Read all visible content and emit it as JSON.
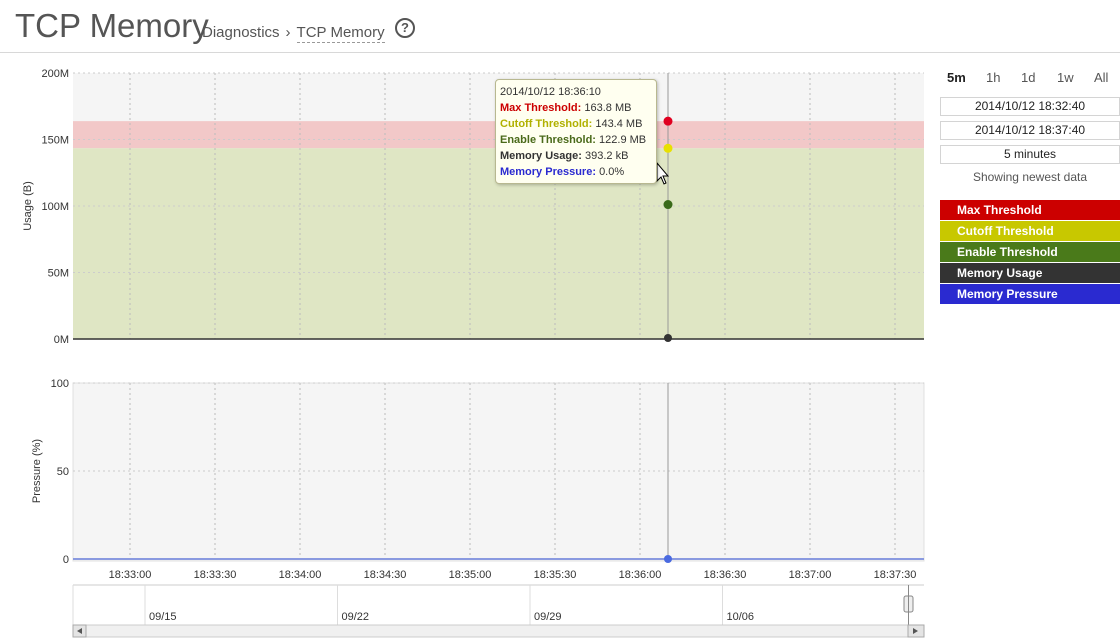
{
  "header": {
    "title": "TCP Memory",
    "breadcrumb_parent": "Diagnostics",
    "breadcrumb_sep": "›",
    "breadcrumb_current": "TCP Memory",
    "help_icon": "?"
  },
  "sidebar": {
    "ranges": [
      "5m",
      "1h",
      "1d",
      "1w",
      "All"
    ],
    "active_range": "5m",
    "start_time": "2014/10/12 18:32:40",
    "end_time": "2014/10/12 18:37:40",
    "duration": "5 minutes",
    "showing": "Showing newest data",
    "legend": [
      {
        "label": "Max Threshold",
        "color": "#cc0000"
      },
      {
        "label": "Cutoff Threshold",
        "color": "#c8c800"
      },
      {
        "label": "Enable Threshold",
        "color": "#4a7a1a"
      },
      {
        "label": "Memory Usage",
        "color": "#333333"
      },
      {
        "label": "Memory Pressure",
        "color": "#2a2ad0"
      }
    ]
  },
  "tooltip": {
    "time": "2014/10/12 18:36:10",
    "rows": [
      {
        "label": "Max Threshold:",
        "value": "163.8 MB",
        "color": "#cc0000"
      },
      {
        "label": "Cutoff Threshold:",
        "value": "143.4 MB",
        "color": "#b0b000"
      },
      {
        "label": "Enable Threshold:",
        "value": "122.9 MB",
        "color": "#4a6a1a"
      },
      {
        "label": "Memory Usage:",
        "value": "393.2 kB",
        "color": "#333333"
      },
      {
        "label": "Memory Pressure:",
        "value": "0.0%",
        "color": "#2a2ad0"
      }
    ]
  },
  "chart_data": [
    {
      "type": "area",
      "ylabel": "Usage (B)",
      "yticks": [
        "200M",
        "150M",
        "100M",
        "50M",
        "0M"
      ],
      "ylim": [
        0,
        200
      ],
      "series": [
        {
          "name": "Max Threshold",
          "value_mb": 163.8,
          "color": "#f2c8c8"
        },
        {
          "name": "Cutoff Threshold",
          "value_mb": 143.4,
          "color": "#dfe6c4"
        },
        {
          "name": "Enable Threshold",
          "value_mb": 122.9,
          "color": "#4a7a1a"
        },
        {
          "name": "Memory Usage",
          "value_mb": 0.3932,
          "color": "#333333"
        }
      ]
    },
    {
      "type": "line",
      "ylabel": "Pressure (%)",
      "yticks": [
        "100",
        "50",
        "0"
      ],
      "ylim": [
        0,
        100
      ],
      "series": [
        {
          "name": "Memory Pressure",
          "value": 0.0,
          "color": "#2a2ad0"
        }
      ]
    }
  ],
  "xaxis": {
    "ticks": [
      "18:33:00",
      "18:33:30",
      "18:34:00",
      "18:34:30",
      "18:35:00",
      "18:35:30",
      "18:36:00",
      "18:36:30",
      "18:37:00",
      "18:37:30"
    ]
  },
  "navigator": {
    "labels": [
      "09/15",
      "09/22",
      "09/29",
      "10/06"
    ]
  }
}
